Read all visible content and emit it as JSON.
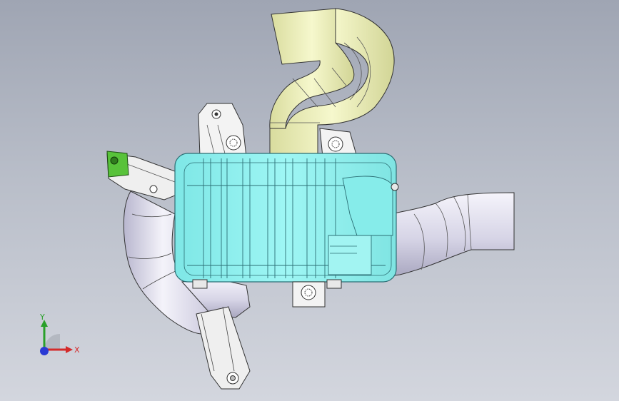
{
  "triad": {
    "x_label": "X",
    "y_label": "Y",
    "colors": {
      "x": "#d42a2a",
      "y": "#2aa02a",
      "z": "#2a3ad4"
    }
  },
  "model": {
    "colors": {
      "canister": "#8ff0ef",
      "canister_edge": "#2c6f75",
      "hose_yellow": "#f2f4c0",
      "hose_yellow_shade": "#d6d99a",
      "pipe_lavender": "#e7e6f3",
      "pipe_lavender_shade": "#bdbbd4",
      "bracket_green": "#58c23a",
      "bracket_white": "#f3f3f3"
    }
  }
}
